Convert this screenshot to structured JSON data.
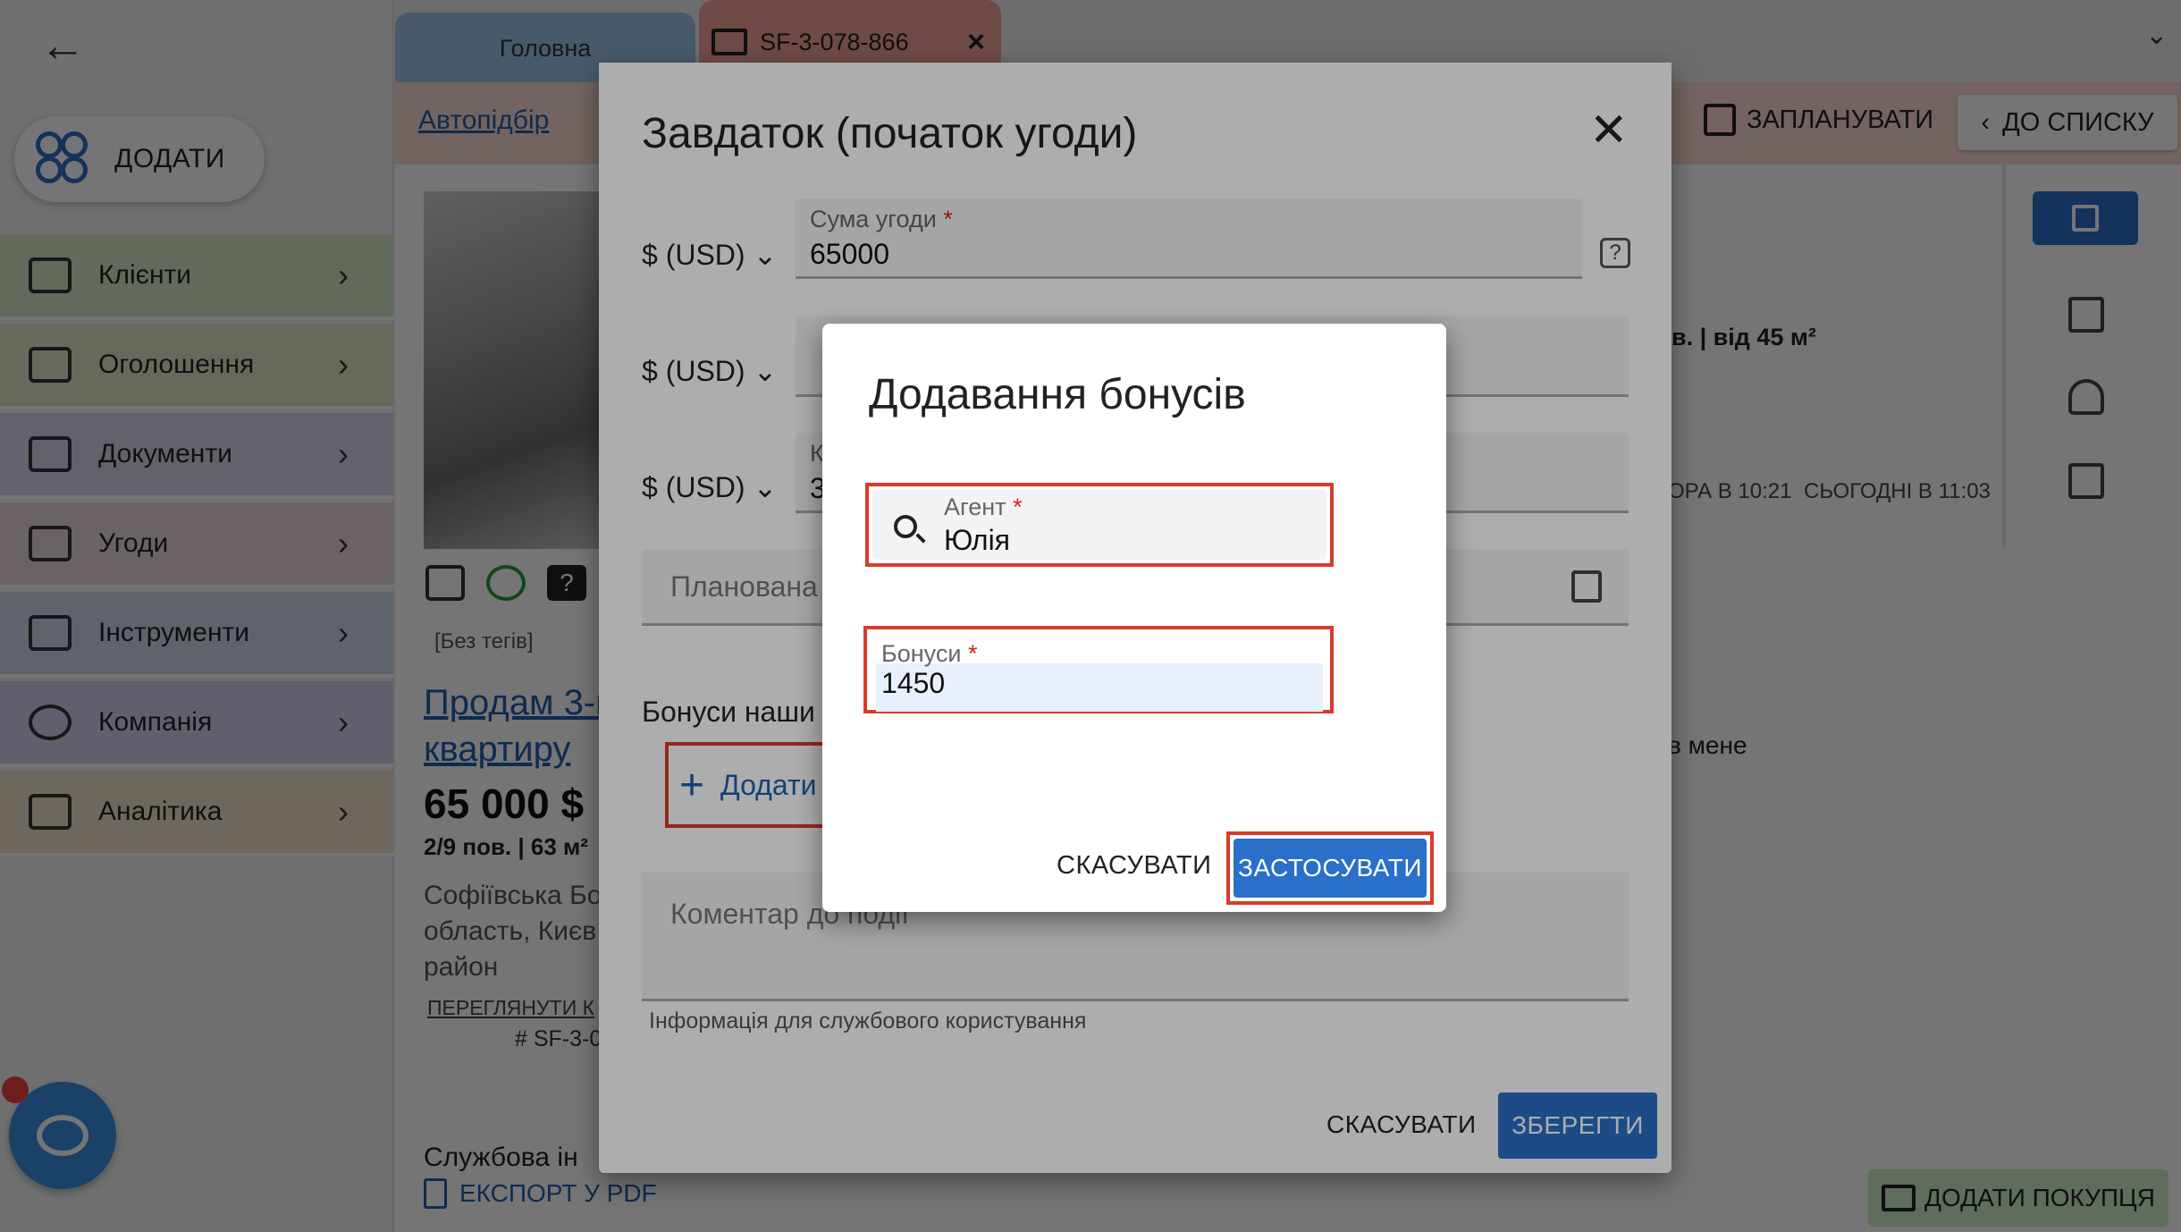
{
  "tabs": {
    "home": "Головна",
    "current": "SF-3-078-866"
  },
  "sidebar": {
    "add_label": "ДОДАТИ",
    "items": [
      {
        "label": "Клієнти",
        "color": "#d6e7c9",
        "icon": "clients-icon"
      },
      {
        "label": "Оголошення",
        "color": "#e2e6c4",
        "icon": "listings-icon"
      },
      {
        "label": "Документи",
        "color": "#dcd4ea",
        "icon": "folder-icon"
      },
      {
        "label": "Угоди",
        "color": "#e8d6e2",
        "icon": "deals-icon"
      },
      {
        "label": "Інструменти",
        "color": "#cfd8ec",
        "icon": "tools-icon"
      },
      {
        "label": "Компанія",
        "color": "#d3d0ec",
        "icon": "copyright-icon"
      },
      {
        "label": "Аналітика",
        "color": "#efe0cc",
        "icon": "analytics-icon"
      }
    ]
  },
  "header": {
    "autopid": "Автопідбір",
    "plan": "ЗАПЛАНУВАТИ",
    "to_list": "ДО СПИСКУ"
  },
  "listing": {
    "no_tags": "[Без тегів]",
    "title_line1": "Продам 3-к",
    "title_line2": "квартиру",
    "price": "65 000 $",
    "floor": "2/9 пов. | 63 м²",
    "address_line1": "Софіївська Бо",
    "address_line2": "область, Києв",
    "address_line3": "район",
    "view": "ПЕРЕГЛЯНУТИ К",
    "sf_number": "# SF-3-0",
    "service": "Службова ін",
    "export": "ЕКСПОРТ У PDF"
  },
  "right_panel": {
    "rooms": "в. | від 45 м²",
    "time1": "ОРА В 10:21",
    "time2": "СЬОГОДНІ В 11:03",
    "mine": "в мене",
    "add_purchase": "ДОДАТИ ПОКУПЦЯ"
  },
  "deposit_dialog": {
    "title": "Завдаток (початок угоди)",
    "currency": "$ (USD)",
    "amount_label": "Сума угоди",
    "amount_value": "65000",
    "field3_label": "К",
    "field3_value": "3",
    "planned_label": "Планована",
    "bonus_label": "Бонуси наши",
    "add_bonus": "Додати",
    "comment_placeholder": "Коментар до події",
    "comment_hint": "Інформація для службового користування",
    "cancel": "СКАСУВАТИ",
    "save": "ЗБЕРЕГТИ"
  },
  "bonus_dialog": {
    "title": "Додавання бонусів",
    "agent_label": "Агент",
    "agent_value": "Юлія",
    "bonus_label": "Бонуси",
    "bonus_value": "1450",
    "cancel": "СКАСУВАТИ",
    "apply": "ЗАСТОСУВАТИ"
  },
  "colors": {
    "accent": "#2a6fc9",
    "highlight": "#d93b2a",
    "required": "#d0271d"
  }
}
